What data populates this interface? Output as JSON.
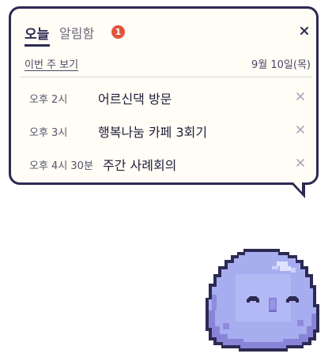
{
  "tabs": {
    "today_label": "오늘",
    "inbox_label": "알림함",
    "inbox_badge": "1"
  },
  "header": {
    "week_link": "이번 주 보기",
    "date": "9월 10일(목)"
  },
  "events": [
    {
      "time": "오후 2시",
      "title": "어르신댁 방문"
    },
    {
      "time": "오후 3시",
      "title": "행복나눔 카페 3회기"
    },
    {
      "time": "오후 4시 30분",
      "title": "주간 사례회의"
    }
  ],
  "colors": {
    "outline": "#2c2a52",
    "bubble_bg": "#fffdf5",
    "badge": "#e0533d",
    "mascot_body": "#a7aef0",
    "mascot_shadow": "#8a84d8"
  }
}
